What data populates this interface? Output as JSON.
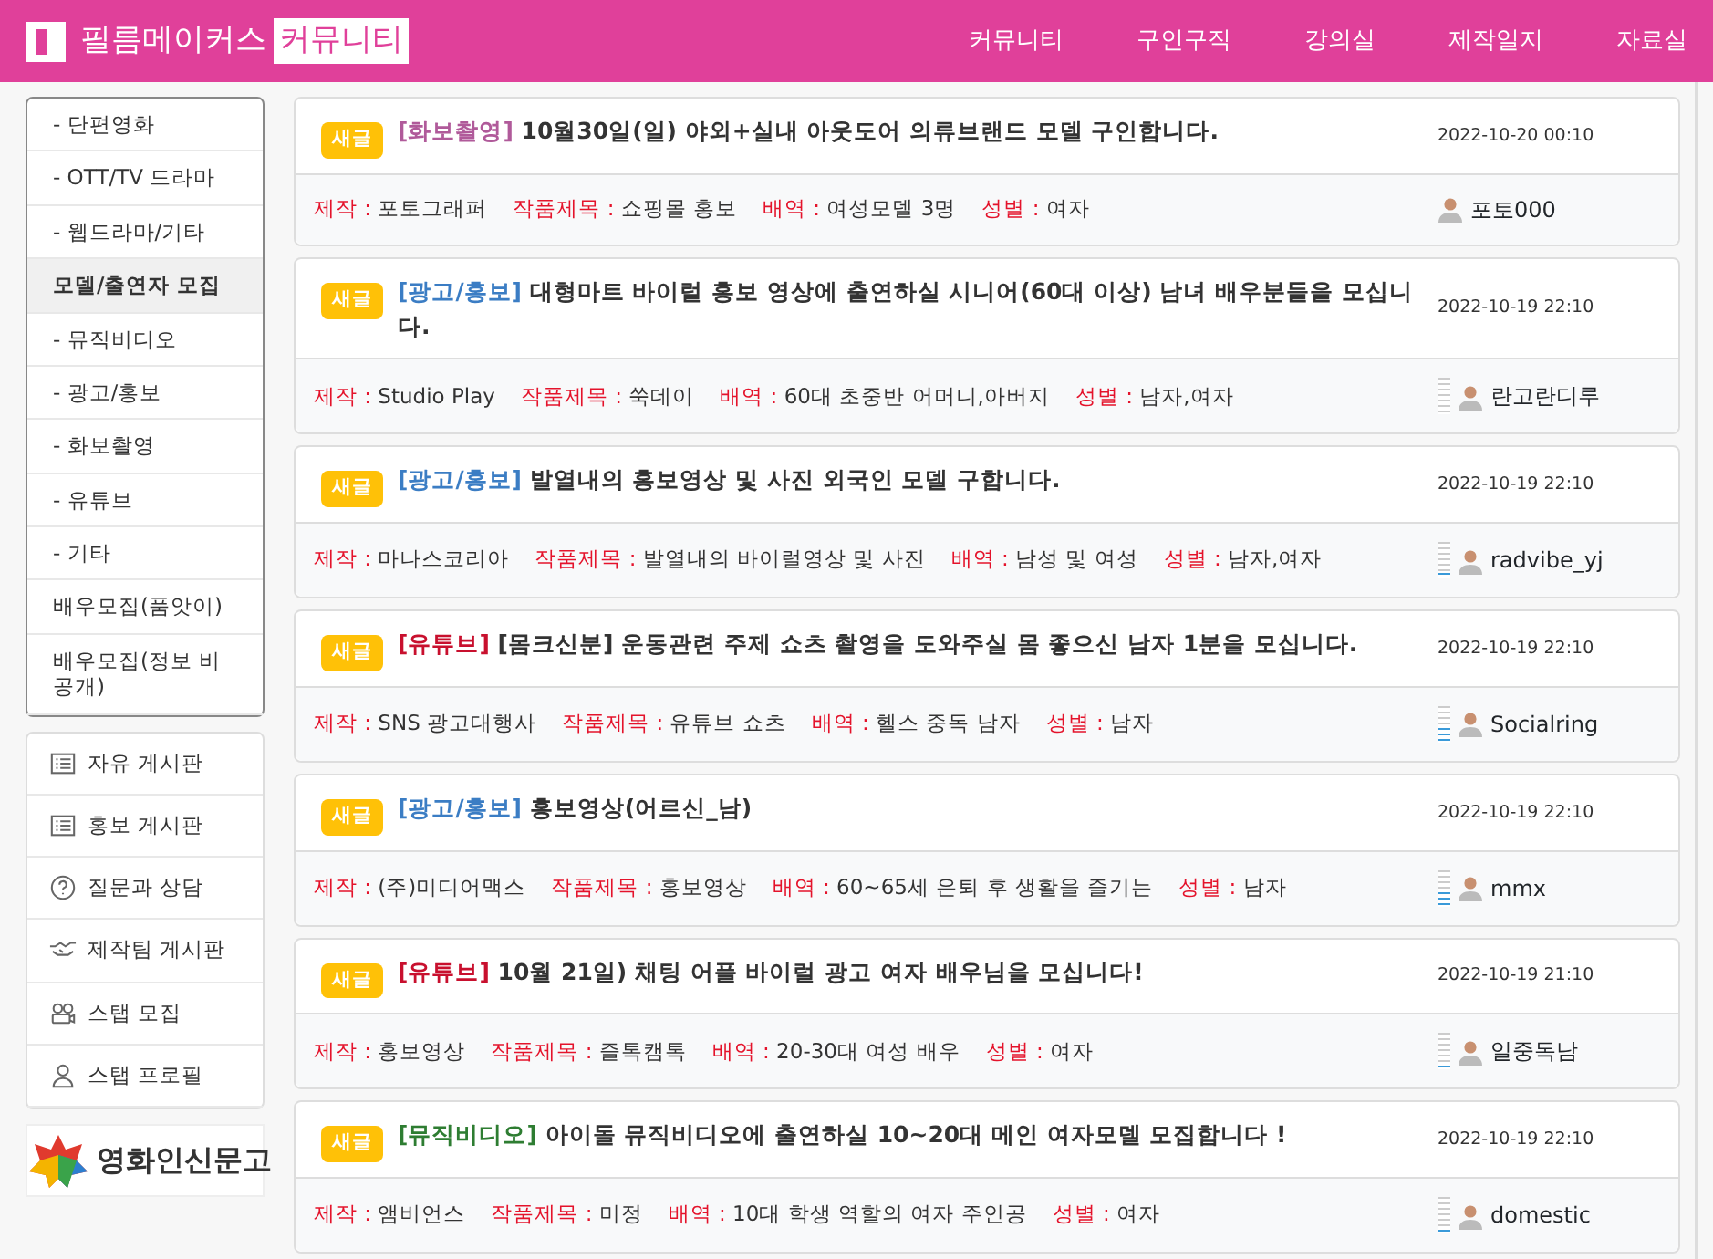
{
  "header": {
    "logo_text": "필름메이커스",
    "logo_tag": "커뮤니티",
    "nav": [
      {
        "label": "커뮤니티"
      },
      {
        "label": "구인구직"
      },
      {
        "label": "강의실"
      },
      {
        "label": "제작일지"
      },
      {
        "label": "자료실"
      }
    ]
  },
  "sidebar": {
    "categories": [
      {
        "label": "- 단편영화",
        "selected": false
      },
      {
        "label": "- OTT/TV 드라마",
        "selected": false
      },
      {
        "label": "- 웹드라마/기타",
        "selected": false
      },
      {
        "label": "모델/출연자 모집",
        "selected": true
      },
      {
        "label": "- 뮤직비디오",
        "selected": false
      },
      {
        "label": "- 광고/홍보",
        "selected": false
      },
      {
        "label": "- 화보촬영",
        "selected": false
      },
      {
        "label": "- 유튜브",
        "selected": false
      },
      {
        "label": "- 기타",
        "selected": false
      },
      {
        "label": "배우모집(품앗이)",
        "selected": false
      },
      {
        "label": "배우모집(정보 비공개)",
        "selected": false
      }
    ],
    "boards": [
      {
        "label": "자유 게시판"
      },
      {
        "label": "홍보 게시판"
      },
      {
        "label": "질문과 상담"
      },
      {
        "label": "제작팀 게시판"
      },
      {
        "label": "스탭 모집"
      },
      {
        "label": "스탭 프로필"
      }
    ],
    "banner": {
      "text": "영화인신문고"
    }
  },
  "posts": [
    {
      "badge": "새글",
      "category": "[화보촬영]",
      "color": "#b05a9a",
      "title": "10월30일(일) 야외+실내 아웃도어 의류브랜드 모델 구인합니다.",
      "date": "2022-10-20 00:10",
      "meta": [
        {
          "label": "제작 :",
          "value": "포토그래퍼"
        },
        {
          "label": "작품제목 :",
          "value": "쇼핑몰 홍보"
        },
        {
          "label": "배역 :",
          "value": "여성모델 3명"
        },
        {
          "label": "성별 :",
          "value": "여자"
        }
      ],
      "author": "포토000"
    },
    {
      "badge": "새글",
      "category": "[광고/홍보]",
      "color": "#3b7dc4",
      "title": "대형마트 바이럴 홍보 영상에 출연하실 시니어(60대 이상) 남녀 배우분들을 모십니다.",
      "date": "2022-10-19 22:10",
      "meta": [
        {
          "label": "제작 :",
          "value": "Studio Play"
        },
        {
          "label": "작품제목 :",
          "value": "쑥데이"
        },
        {
          "label": "배역 :",
          "value": "60대 초중반 어머니,아버지"
        },
        {
          "label": "성별 :",
          "value": "남자,여자"
        }
      ],
      "author": "란고란디루",
      "level": 0
    },
    {
      "badge": "새글",
      "category": "[광고/홍보]",
      "color": "#3b7dc4",
      "title": "발열내의 홍보영상 및 사진 외국인 모델 구합니다.",
      "date": "2022-10-19 22:10",
      "meta": [
        {
          "label": "제작 :",
          "value": "마나스코리아"
        },
        {
          "label": "작품제목 :",
          "value": "발열내의 바이럴영상 및 사진"
        },
        {
          "label": "배역 :",
          "value": "남성 및 여성"
        },
        {
          "label": "성별 :",
          "value": "남자,여자"
        }
      ],
      "author": "radvibe_yj",
      "level": 0.15
    },
    {
      "badge": "새글",
      "category": "[유튜브]",
      "color": "#c8102e",
      "title": "[몸크신분] 운동관련 주제 쇼츠 촬영을 도와주실 몸 좋으신 남자 1분을 모십니다.",
      "date": "2022-10-19 22:10",
      "meta": [
        {
          "label": "제작 :",
          "value": "SNS 광고대행사"
        },
        {
          "label": "작품제목 :",
          "value": "유튜브 쇼츠"
        },
        {
          "label": "배역 :",
          "value": "헬스 중독 남자"
        },
        {
          "label": "성별 :",
          "value": "남자"
        }
      ],
      "author": "Socialring",
      "level": 0.4
    },
    {
      "badge": "새글",
      "category": "[광고/홍보]",
      "color": "#3b7dc4",
      "title": "홍보영상(어르신_남)",
      "date": "2022-10-19 22:10",
      "meta": [
        {
          "label": "제작 :",
          "value": "(주)미디어맥스"
        },
        {
          "label": "작품제목 :",
          "value": "홍보영상"
        },
        {
          "label": "배역 :",
          "value": "60~65세 은퇴 후 생활을 즐기는"
        },
        {
          "label": "성별 :",
          "value": "남자"
        }
      ],
      "author": "mmx",
      "level": 0.4
    },
    {
      "badge": "새글",
      "category": "[유튜브]",
      "color": "#c8102e",
      "title": "10월 21일) 채팅 어플 바이럴 광고 여자 배우님을 모십니다!",
      "date": "2022-10-19 21:10",
      "meta": [
        {
          "label": "제작 :",
          "value": "홍보영상"
        },
        {
          "label": "작품제목 :",
          "value": "즐톡캠톡"
        },
        {
          "label": "배역 :",
          "value": "20-30대 여성 배우"
        },
        {
          "label": "성별 :",
          "value": "여자"
        }
      ],
      "author": "일중독남",
      "level": 0.1
    },
    {
      "badge": "새글",
      "category": "[뮤직비디오]",
      "color": "#2e7d32",
      "title": "아이돌 뮤직비디오에 출연하실 10~20대 메인 여자모델 모집합니다 !",
      "date": "2022-10-19 22:10",
      "meta": [
        {
          "label": "제작 :",
          "value": "앰비언스"
        },
        {
          "label": "작품제목 :",
          "value": "미정"
        },
        {
          "label": "배역 :",
          "value": "10대 학생 역할의 여자 주인공"
        },
        {
          "label": "성별 :",
          "value": "여자"
        }
      ],
      "author": "domestic",
      "level": 0.1
    }
  ]
}
